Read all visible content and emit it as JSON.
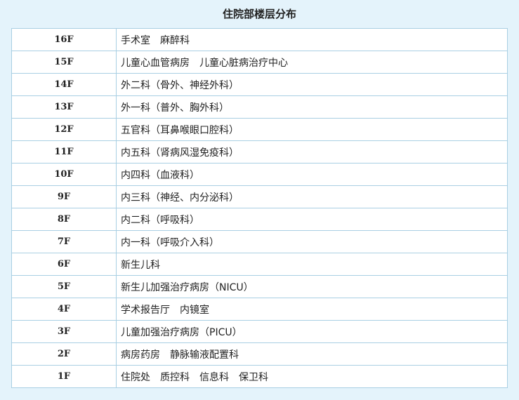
{
  "title": "住院部楼层分布",
  "rows": [
    {
      "floor": "16F",
      "departments": "手术室　麻醉科"
    },
    {
      "floor": "15F",
      "departments": "儿童心血管病房　儿童心脏病治疗中心"
    },
    {
      "floor": "14F",
      "departments": "外二科（骨外、神经外科）"
    },
    {
      "floor": "13F",
      "departments": "外一科（普外、胸外科）"
    },
    {
      "floor": "12F",
      "departments": "五官科（耳鼻喉眼口腔科）"
    },
    {
      "floor": "11F",
      "departments": "内五科（肾病风湿免疫科）"
    },
    {
      "floor": "10F",
      "departments": "内四科（血液科）"
    },
    {
      "floor": "9F",
      "departments": "内三科（神经、内分泌科）"
    },
    {
      "floor": "8F",
      "departments": "内二科（呼吸科）"
    },
    {
      "floor": "7F",
      "departments": "内一科（呼吸介入科）"
    },
    {
      "floor": "6F",
      "departments": "新生儿科"
    },
    {
      "floor": "5F",
      "departments": "新生儿加强治疗病房（NICU）"
    },
    {
      "floor": "4F",
      "departments": "学术报告厅　内镜室"
    },
    {
      "floor": "3F",
      "departments": "儿童加强治疗病房（PICU）"
    },
    {
      "floor": "2F",
      "departments": "病房药房　静脉输液配置科"
    },
    {
      "floor": "1F",
      "departments": "住院处　质控科　信息科　保卫科"
    }
  ],
  "colors": {
    "background": "#e4f3fb",
    "border": "#a9cfe3",
    "cell": "#ffffff",
    "text": "#222222"
  }
}
